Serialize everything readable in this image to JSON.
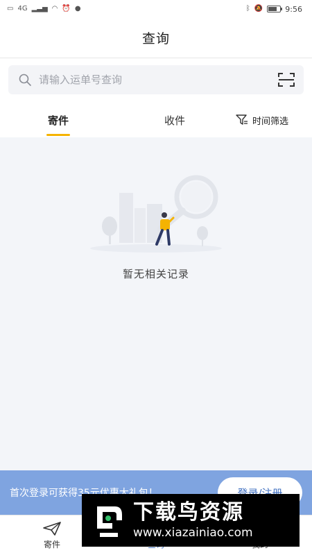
{
  "status_bar": {
    "left_icons": [
      "hd-icon",
      "signal-icon",
      "wifi-icon",
      "alarm-icon",
      "chat-bubble-icon"
    ],
    "network_label": "4G",
    "time": "9:56"
  },
  "header": {
    "title": "查询"
  },
  "search": {
    "placeholder": "请输入运单号查询"
  },
  "tabs": [
    {
      "label": "寄件",
      "active": true
    },
    {
      "label": "收件",
      "active": false
    }
  ],
  "filter": {
    "label": "时间筛选"
  },
  "empty_state": {
    "message": "暂无相关记录"
  },
  "login_banner": {
    "text": "首次登录可获得35元优惠大礼包！",
    "button_label": "登录/注册"
  },
  "bottom_nav": [
    {
      "label": "寄件",
      "icon": "paper-plane-icon",
      "active": false
    },
    {
      "label": "查询",
      "icon": "search-icon",
      "active": true
    },
    {
      "label": "我的",
      "icon": "user-icon",
      "active": false
    }
  ],
  "watermark": {
    "title": "下载鸟资源",
    "url": "www.xiazainiao.com"
  },
  "colors": {
    "accent_underline": "#f5b301",
    "banner_bg": "#7fa4e0",
    "page_bg": "#f3f5f9"
  }
}
